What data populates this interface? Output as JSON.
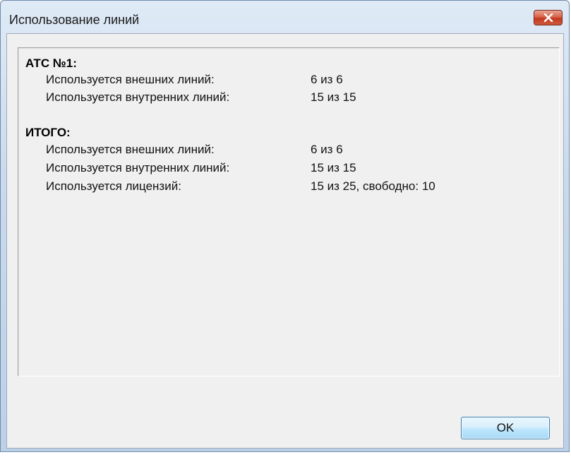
{
  "window": {
    "title": "Использование линий"
  },
  "sections": [
    {
      "title": "АТС №1:",
      "rows": [
        {
          "label": "Используется внешних линий:",
          "value": "6 из 6"
        },
        {
          "label": "Используется внутренних линий:",
          "value": "15 из 15"
        }
      ]
    },
    {
      "title": "ИТОГО:",
      "rows": [
        {
          "label": "Используется внешних линий:",
          "value": "6 из 6"
        },
        {
          "label": "Используется внутренних линий:",
          "value": "15 из 15"
        },
        {
          "label": "Используется лицензий:",
          "value": "15 из 25, свободно: 10"
        }
      ]
    }
  ],
  "buttons": {
    "ok_label": "OK"
  },
  "icons": {
    "close": "close-icon"
  },
  "colors": {
    "close_button": "#c9482c",
    "ok_button_border": "#3c7fb1"
  }
}
